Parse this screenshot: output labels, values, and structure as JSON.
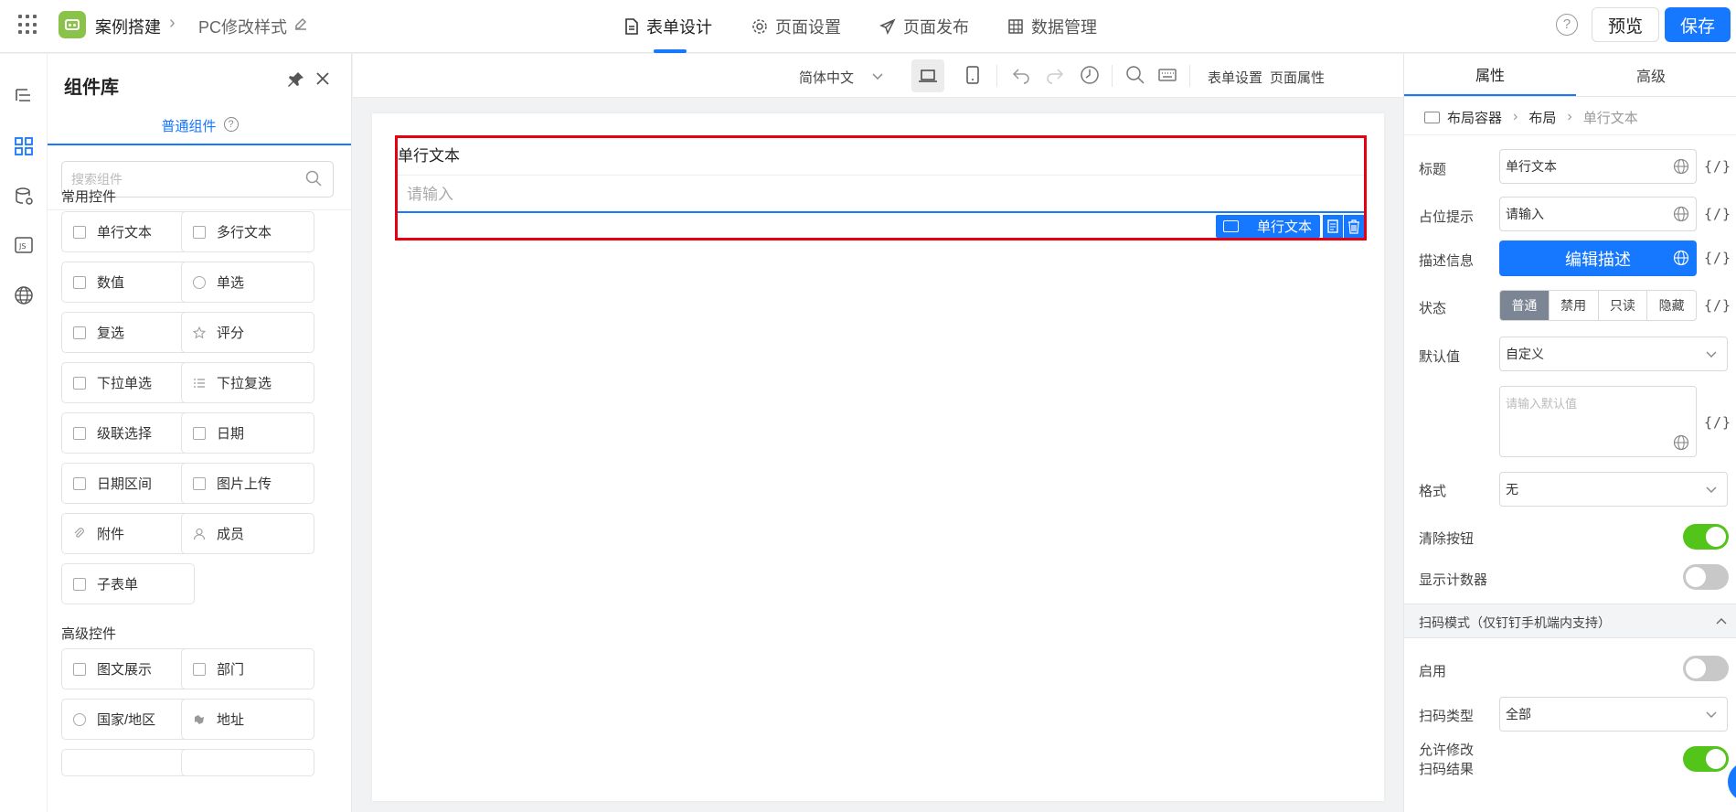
{
  "topbar": {
    "app_name": "案例搭建",
    "page_name": "PC修改样式",
    "nav": [
      {
        "label": "表单设计",
        "icon": "document-icon",
        "active": true
      },
      {
        "label": "页面设置",
        "icon": "gear-icon",
        "active": false
      },
      {
        "label": "页面发布",
        "icon": "send-icon",
        "active": false
      },
      {
        "label": "数据管理",
        "icon": "table-icon",
        "active": false
      }
    ],
    "preview_label": "预览",
    "save_label": "保存"
  },
  "library": {
    "title": "组件库",
    "tab_label": "普通组件",
    "search_placeholder": "搜索组件",
    "group_common": "常用控件",
    "common": [
      "单行文本",
      "多行文本",
      "数值",
      "单选",
      "复选",
      "评分",
      "下拉单选",
      "下拉复选",
      "级联选择",
      "日期",
      "日期区间",
      "图片上传",
      "附件",
      "成员",
      "子表单"
    ],
    "group_advanced": "高级控件",
    "advanced": [
      "图文展示",
      "部门",
      "国家/地区",
      "地址"
    ]
  },
  "toolbar": {
    "language": "简体中文",
    "form_settings": "表单设置",
    "page_props": "页面属性"
  },
  "canvas": {
    "field_label": "单行文本",
    "field_placeholder": "请输入",
    "selected_tag": "单行文本"
  },
  "props": {
    "tabs": [
      "属性",
      "高级"
    ],
    "breadcrumb": [
      "布局容器",
      "布局",
      "单行文本"
    ],
    "title_label": "标题",
    "title_value": "单行文本",
    "placeholder_label": "占位提示",
    "placeholder_value": "请输入",
    "desc_label": "描述信息",
    "desc_button": "编辑描述",
    "state_label": "状态",
    "states": [
      "普通",
      "禁用",
      "只读",
      "隐藏"
    ],
    "default_label": "默认值",
    "default_mode": "自定义",
    "default_placeholder": "请输入默认值",
    "format_label": "格式",
    "format_value": "无",
    "clear_label": "清除按钮",
    "clear_on": true,
    "counter_label": "显示计数器",
    "counter_on": false,
    "scan_section": "扫码模式（仅钉钉手机端内支持）",
    "enable_label": "启用",
    "enable_on": false,
    "scan_type_label": "扫码类型",
    "scan_type_value": "全部",
    "allow_edit_label_1": "允许修改",
    "allow_edit_label_2": "扫码结果",
    "allow_edit_on": true,
    "var_expr": "{/}"
  },
  "colors": {
    "accent": "#1677ff",
    "selection": "#e60012",
    "toggle_on": "#52c41a"
  }
}
